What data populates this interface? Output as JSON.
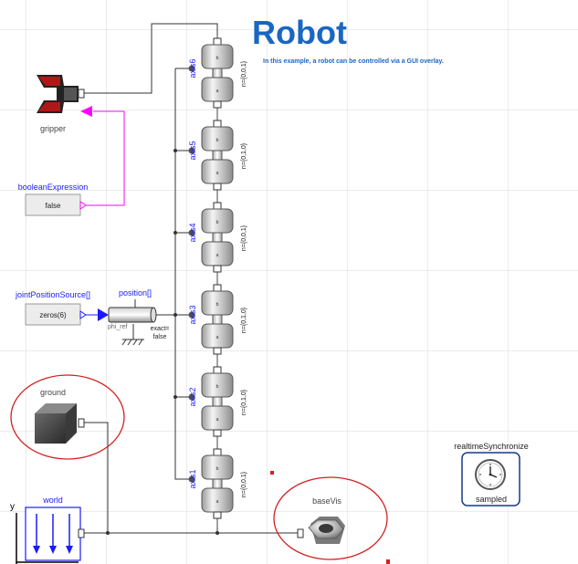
{
  "title": "Robot",
  "subtitle": "In this example, a robot can be controlled via a GUI overlay.",
  "colors": {
    "title": "#1a66c2",
    "label": "#1a1aff",
    "grid": "#d8d8d8",
    "pink": "#ff00ff",
    "annotation_red": "#d42020"
  },
  "components": {
    "gripper": "gripper",
    "boolean_expression": {
      "label": "booleanExpression",
      "value": "false"
    },
    "joint_position_source": {
      "label": "jointPositionSource[]",
      "value": "zeros(6)"
    },
    "position": {
      "label": "position[]",
      "phi_ref": "phi_ref",
      "exact": "exact=\nfalse"
    },
    "ground": "ground",
    "world": {
      "label": "world",
      "axis_y": "y"
    },
    "base_vis": "baseVis",
    "realtime": {
      "label": "realtimeSynchronize",
      "mode": "sampled"
    }
  },
  "joints": [
    {
      "name": "axis6",
      "n": "n={0,0,1}"
    },
    {
      "name": "axis5",
      "n": "n={0,1,0}"
    },
    {
      "name": "axis4",
      "n": "n={0,0,1}"
    },
    {
      "name": "axis3",
      "n": "n={0,1,0}"
    },
    {
      "name": "axis2",
      "n": "n={0,1,0}"
    },
    {
      "name": "axis1",
      "n": "n={0,0,1}"
    }
  ],
  "port_letters": {
    "a": "a",
    "b": "b"
  },
  "icons": {
    "gripper": "gripper-icon",
    "ground": "cube-icon",
    "world": "world-arrows-icon",
    "base_vis": "nut-icon",
    "realtime": "clock-icon"
  }
}
